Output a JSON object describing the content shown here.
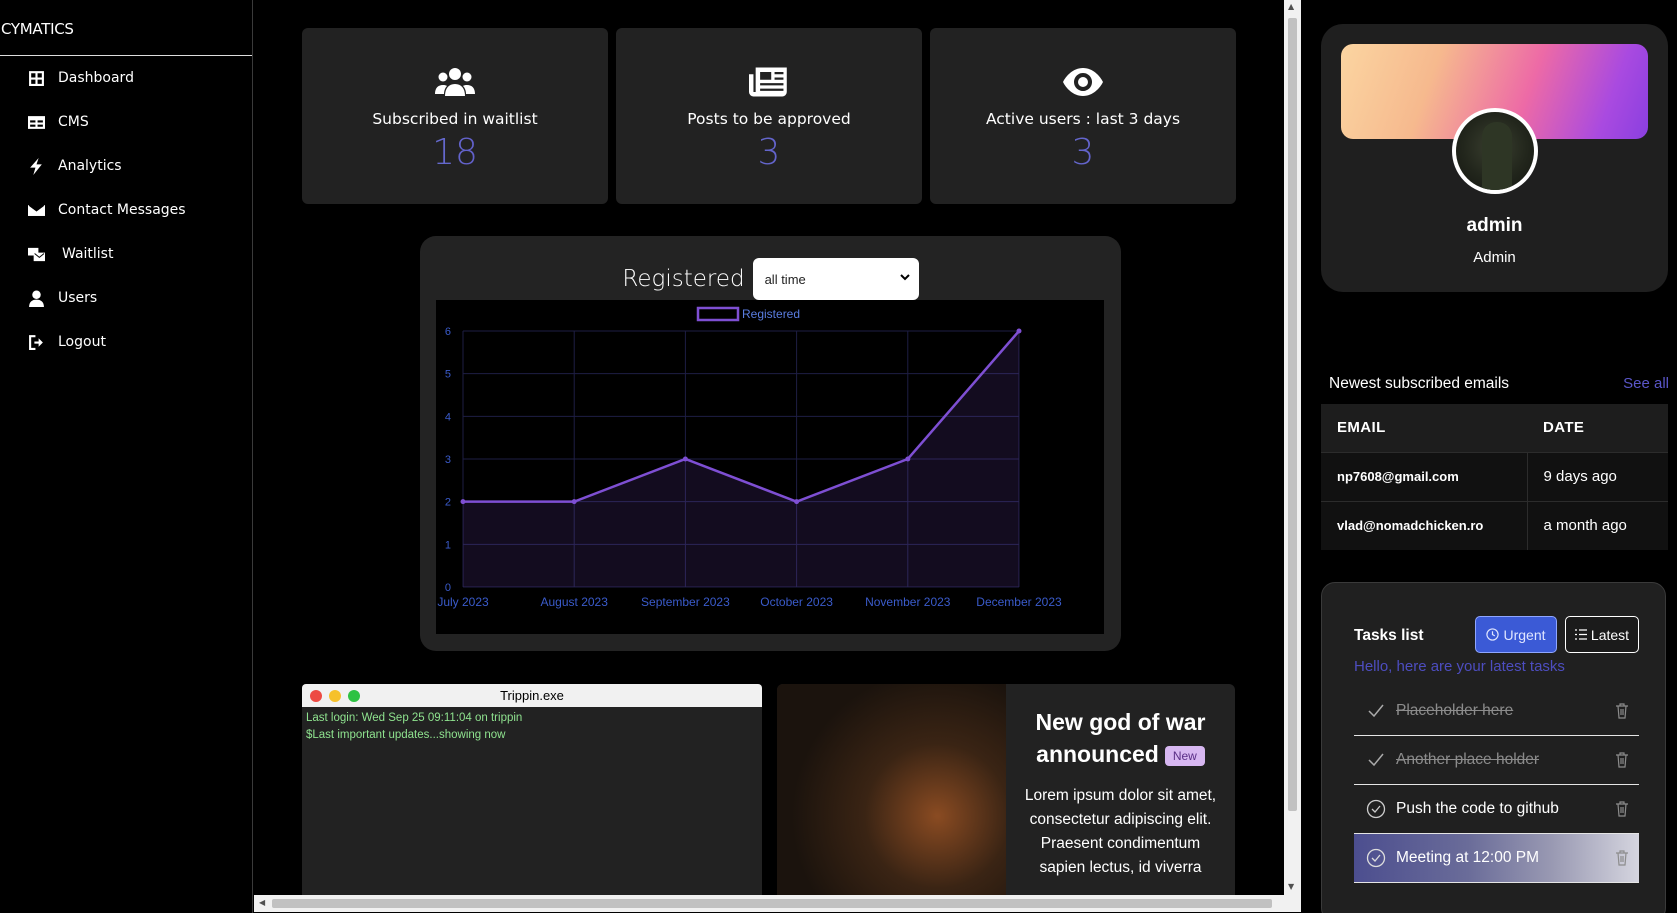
{
  "brand": "CYMATICS",
  "nav": [
    {
      "label": "Dashboard",
      "icon": "dashboard-icon"
    },
    {
      "label": "CMS",
      "icon": "table-icon"
    },
    {
      "label": "Analytics",
      "icon": "bolt-icon"
    },
    {
      "label": "Contact Messages",
      "icon": "envelope-icon"
    },
    {
      "label": "Waitlist",
      "icon": "mail-list-icon"
    },
    {
      "label": "Users",
      "icon": "user-icon"
    },
    {
      "label": "Logout",
      "icon": "logout-icon"
    }
  ],
  "stats": [
    {
      "label": "Subscribed in waitlist",
      "value": "18",
      "icon": "users-icon"
    },
    {
      "label": "Posts to be approved",
      "value": "3",
      "icon": "newspaper-icon"
    },
    {
      "label": "Active users : last 3 days",
      "value": "3",
      "icon": "eye-icon"
    }
  ],
  "registered": {
    "title": "Registered",
    "select_value": "all time"
  },
  "chart_data": {
    "type": "area",
    "categories": [
      "July 2023",
      "August 2023",
      "September 2023",
      "October 2023",
      "November 2023",
      "December 2023"
    ],
    "series": [
      {
        "name": "Registered",
        "values": [
          2,
          2,
          3,
          2,
          3,
          6
        ]
      }
    ],
    "ylim": [
      0,
      6
    ],
    "yticks": [
      "0",
      "1",
      "2",
      "3",
      "4",
      "5",
      "6"
    ],
    "legend": "top",
    "grid": true,
    "line_color": "#7e4fd3"
  },
  "terminal": {
    "title": "Trippin.exe",
    "lines": [
      "Last login: Wed Sep 25 09:11:04 on trippin",
      "$Last important updates...showing now"
    ]
  },
  "news": {
    "title": "New god of war announced",
    "badge": "New",
    "text": "Lorem ipsum dolor sit amet, consectetur adipiscing elit. Praesent condimentum sapien lectus, id viverra"
  },
  "profile": {
    "name": "admin",
    "role": "Admin"
  },
  "emails": {
    "heading": "Newest subscribed emails",
    "see_all": "See all",
    "columns": [
      "EMAIL",
      "DATE"
    ],
    "rows": [
      {
        "email": "np7608@gmail.com",
        "date": "9 days ago"
      },
      {
        "email": "vlad@nomadchicken.ro",
        "date": "a month ago"
      }
    ]
  },
  "tasks": {
    "title": "Tasks list",
    "urgent_label": "Urgent",
    "latest_label": "Latest",
    "subtitle": "Hello, here are your latest tasks",
    "items": [
      {
        "label": "Placeholder here",
        "done": true
      },
      {
        "label": "Another place holder",
        "done": true
      },
      {
        "label": "Push the code to github",
        "done": false
      },
      {
        "label": "Meeting at 12:00 PM",
        "done": false
      }
    ]
  }
}
